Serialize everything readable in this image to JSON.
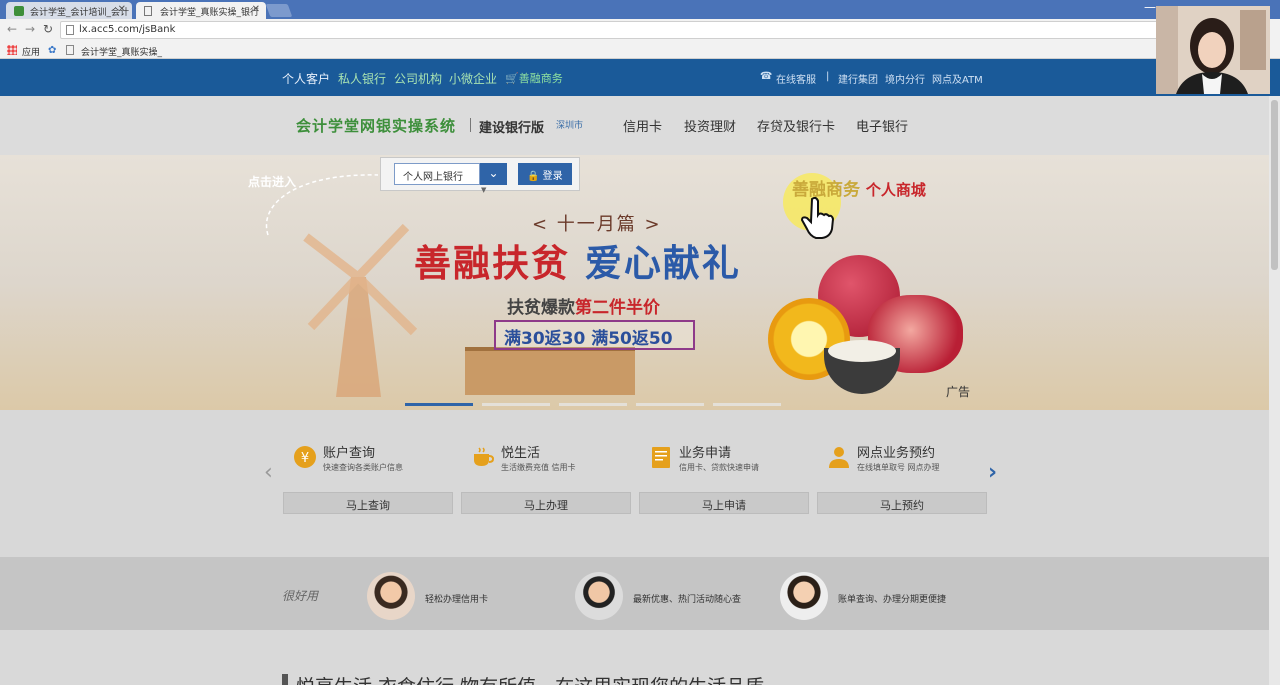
{
  "browser": {
    "tabs": [
      {
        "title": "会计学堂_会计培训_会计"
      },
      {
        "title": "会计学堂_真账实操_银行"
      }
    ],
    "address": "lx.acc5.com/jsBank",
    "bookmarks": [
      {
        "label": "应用"
      },
      {
        "label": "会计学堂_真账实操_"
      }
    ]
  },
  "top_nav": {
    "links": [
      "个人客户",
      "私人银行",
      "公司机构",
      "小微企业"
    ],
    "shop_link": "善融商务",
    "right_links": [
      "在线客服",
      "建行集团",
      "境内分行",
      "网点及ATM"
    ],
    "separator": "|"
  },
  "header": {
    "logo": "会计学堂网银实操系统",
    "edition": "建设银行版",
    "city": "深圳市",
    "nav": [
      "信用卡",
      "投资理财",
      "存贷及银行卡",
      "电子银行"
    ]
  },
  "login": {
    "select_value": "个人网上银行",
    "login_button": "登录",
    "click_hint": "点击进入"
  },
  "banner": {
    "shop_brand": "善融商务",
    "shop_sub": "个人商城",
    "month": "< 十一月篇 >",
    "headline_part1": "善融扶贫",
    "headline_part2": "爱心献礼",
    "subline_part1": "扶贫爆款",
    "subline_part2": "第二件半价",
    "promo": "满30返30 满50返50",
    "ad_tag": "广告",
    "slide_count": 5,
    "active_slide": 1
  },
  "services": [
    {
      "title": "账户查询",
      "desc": "快速查询各类账户信息",
      "button": "马上查询",
      "icon": "yen-coin-icon"
    },
    {
      "title": "悦生活",
      "desc": "生活缴费充值 信用卡",
      "button": "马上办理",
      "icon": "coffee-cup-icon"
    },
    {
      "title": "业务申请",
      "desc": "信用卡、贷款快速申请",
      "button": "马上申请",
      "icon": "document-icon"
    },
    {
      "title": "网点业务预约",
      "desc": "在线填单取号 网点办理",
      "button": "马上预约",
      "icon": "person-icon"
    }
  ],
  "good_use": {
    "label": "很好用",
    "items": [
      {
        "text": "轻松办理信用卡"
      },
      {
        "text": "最新优惠、热门活动随心查"
      },
      {
        "text": "账单查询、办理分期更便捷"
      }
    ]
  },
  "slogan": "悦享生活 衣食住行 物有所值，在这里实现您的生活品质",
  "colors": {
    "top_nav_bg": "#1a5a99",
    "primary_blue": "#2f64a8",
    "logo_green": "#3d8f3b",
    "headline_red": "#c8262b"
  }
}
